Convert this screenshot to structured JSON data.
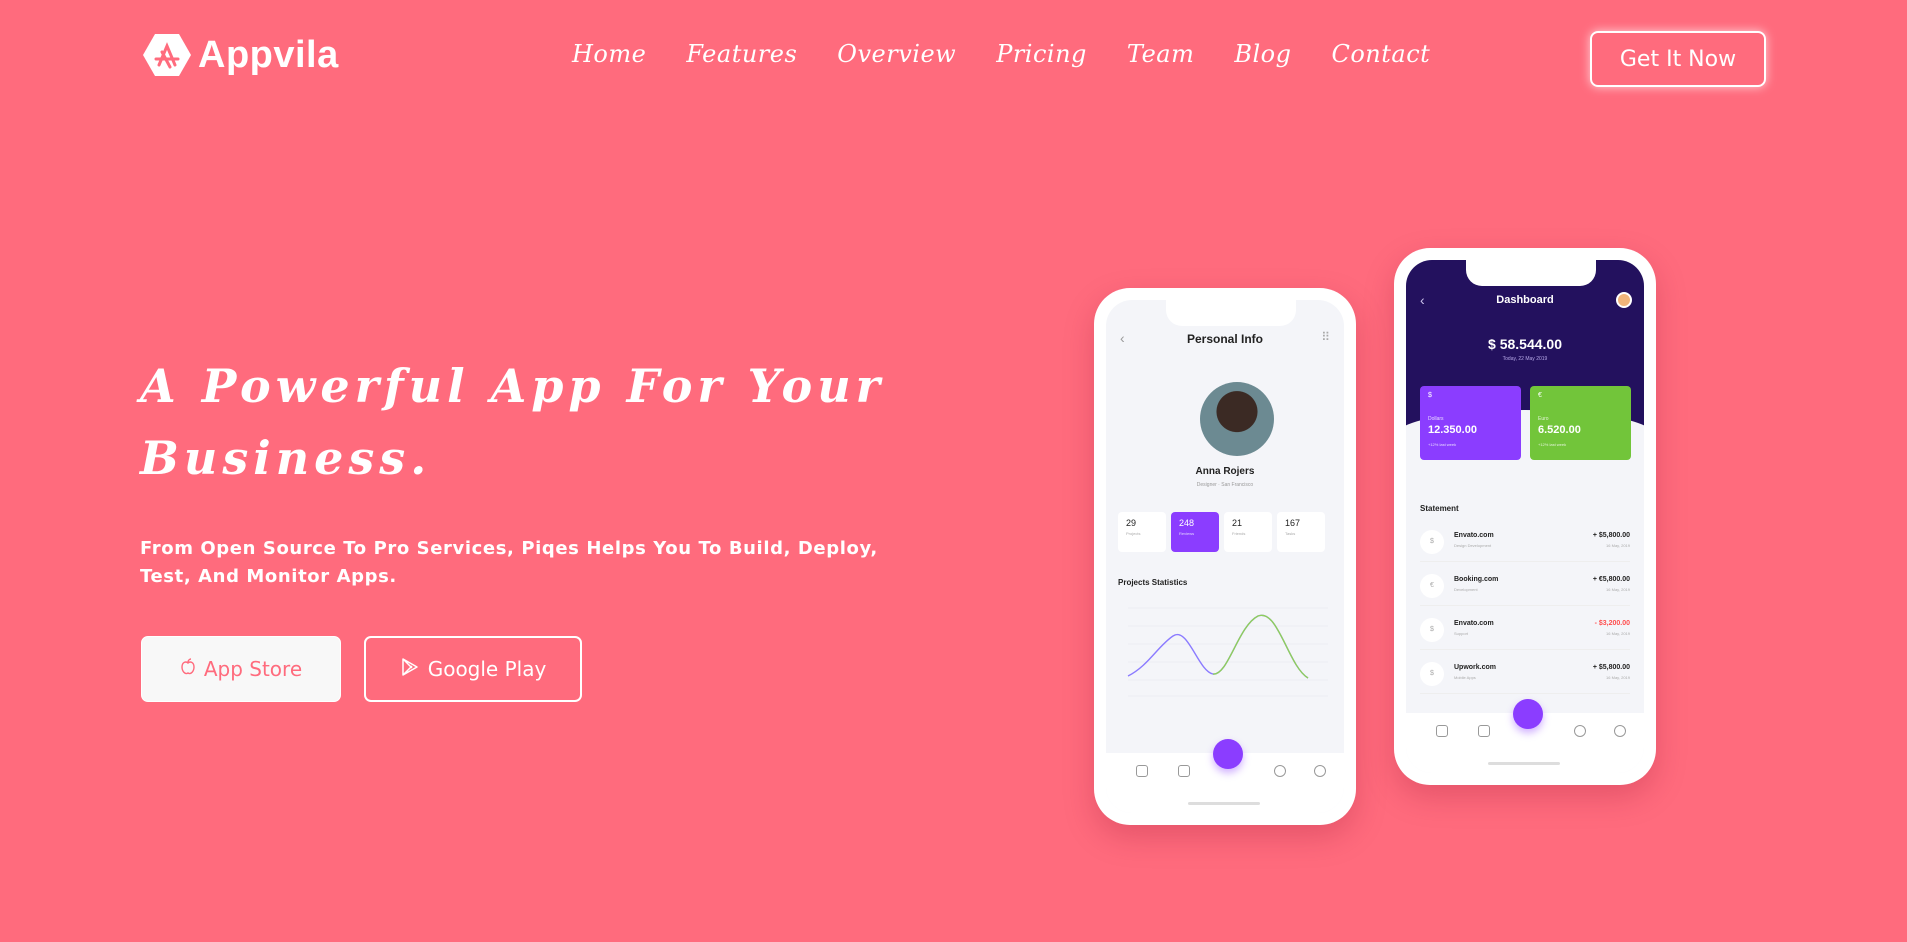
{
  "brand": {
    "name": "Appvila"
  },
  "nav": {
    "items": [
      "Home",
      "Features",
      "Overview",
      "Pricing",
      "Team",
      "Blog",
      "Contact"
    ]
  },
  "header": {
    "cta_label": "Get It Now"
  },
  "hero": {
    "title": "A Powerful App For Your Business.",
    "description": "From Open Source To Pro Services, Piqes Helps You To Build, Deploy, Test, And Monitor Apps.",
    "app_store_label": "App Store",
    "google_play_label": "Google Play"
  },
  "colors": {
    "background": "#ff6b7d",
    "accent_purple": "#8b3dff",
    "accent_green": "#72c53a",
    "dashboard_navy": "#23115e"
  },
  "phone_profile": {
    "title": "Personal Info",
    "name": "Anna Rojers",
    "role": "Designer · San Francisco",
    "stats": [
      {
        "value": "29",
        "label": "Projects"
      },
      {
        "value": "248",
        "label": "Reviews"
      },
      {
        "value": "21",
        "label": "Friends"
      },
      {
        "value": "167",
        "label": "Tasks"
      }
    ],
    "section": "Projects Statistics"
  },
  "phone_dashboard": {
    "title": "Dashboard",
    "balance": "$ 58.544.00",
    "date": "Today, 22 May 2019",
    "cards": [
      {
        "symbol": "$",
        "name": "Dollars",
        "value": "12.350.00",
        "sub": "+12% last week"
      },
      {
        "symbol": "€",
        "name": "Euro",
        "value": "6.520.00",
        "sub": "+12% last week"
      }
    ],
    "section": "Statement",
    "transactions": [
      {
        "icon": "$",
        "name": "Envato.com",
        "sub": "Design Development",
        "amount": "+ $5,800.00",
        "date": "16 May, 2019"
      },
      {
        "icon": "€",
        "name": "Booking.com",
        "sub": "Development",
        "amount": "+ €5,800.00",
        "date": "16 May, 2019"
      },
      {
        "icon": "$",
        "name": "Envato.com",
        "sub": "Support",
        "amount": "- $3,200.00",
        "date": "16 May, 2019"
      },
      {
        "icon": "$",
        "name": "Upwork.com",
        "sub": "Mobile Apps",
        "amount": "+ $5,800.00",
        "date": "16 May, 2019"
      }
    ]
  }
}
